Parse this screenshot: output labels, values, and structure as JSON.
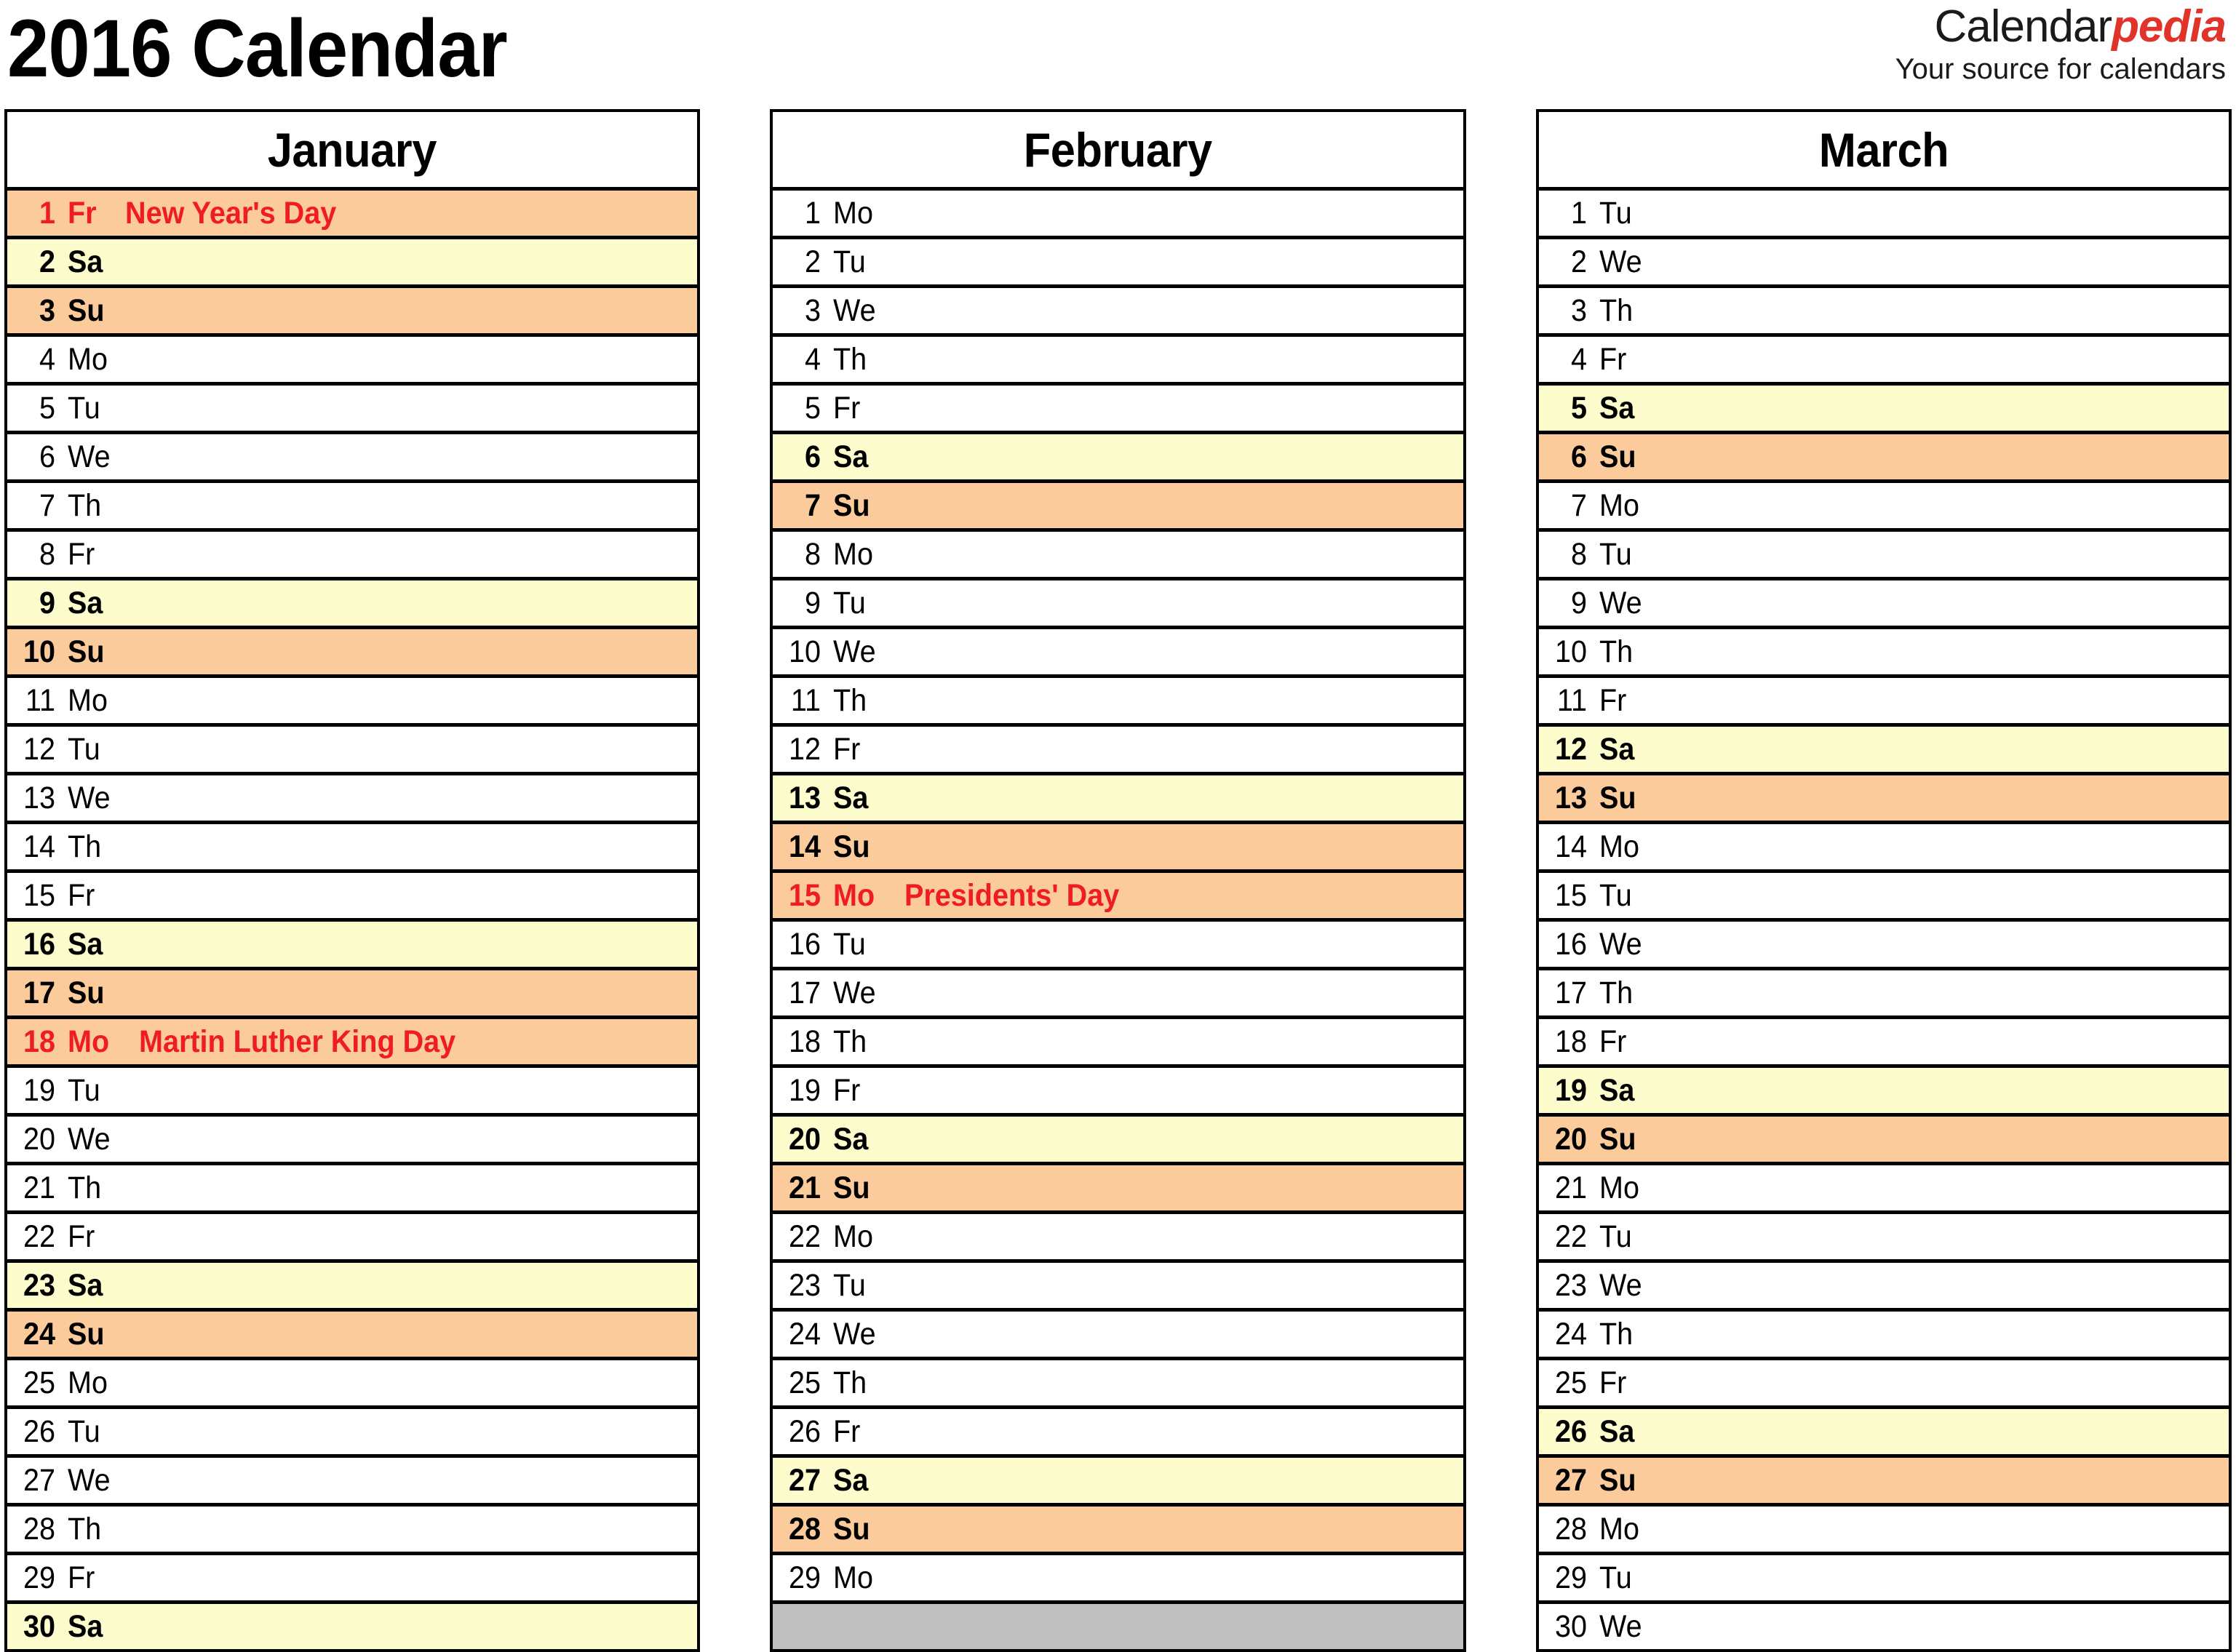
{
  "header": {
    "title": "2016 Calendar",
    "brand_name_black": "Calendar",
    "brand_name_red": "pedia",
    "brand_tagline": "Your source for calendars"
  },
  "colors": {
    "saturday_bg": "#FCFCCC",
    "sunday_bg": "#FBCB9C",
    "holiday_bg": "#FBCB9C",
    "holiday_text": "#EF1C22",
    "filler_bg": "#C0C0C0",
    "border": "#000000",
    "brand_red": "#E0342B"
  },
  "months": [
    {
      "name": "January",
      "days": [
        {
          "num": "1",
          "wd": "Fr",
          "event": "New Year's Day",
          "kind": "holiday"
        },
        {
          "num": "2",
          "wd": "Sa",
          "event": "",
          "kind": "sat"
        },
        {
          "num": "3",
          "wd": "Su",
          "event": "",
          "kind": "sun"
        },
        {
          "num": "4",
          "wd": "Mo",
          "event": "",
          "kind": "weekday"
        },
        {
          "num": "5",
          "wd": "Tu",
          "event": "",
          "kind": "weekday"
        },
        {
          "num": "6",
          "wd": "We",
          "event": "",
          "kind": "weekday"
        },
        {
          "num": "7",
          "wd": "Th",
          "event": "",
          "kind": "weekday"
        },
        {
          "num": "8",
          "wd": "Fr",
          "event": "",
          "kind": "weekday"
        },
        {
          "num": "9",
          "wd": "Sa",
          "event": "",
          "kind": "sat"
        },
        {
          "num": "10",
          "wd": "Su",
          "event": "",
          "kind": "sun"
        },
        {
          "num": "11",
          "wd": "Mo",
          "event": "",
          "kind": "weekday"
        },
        {
          "num": "12",
          "wd": "Tu",
          "event": "",
          "kind": "weekday"
        },
        {
          "num": "13",
          "wd": "We",
          "event": "",
          "kind": "weekday"
        },
        {
          "num": "14",
          "wd": "Th",
          "event": "",
          "kind": "weekday"
        },
        {
          "num": "15",
          "wd": "Fr",
          "event": "",
          "kind": "weekday"
        },
        {
          "num": "16",
          "wd": "Sa",
          "event": "",
          "kind": "sat"
        },
        {
          "num": "17",
          "wd": "Su",
          "event": "",
          "kind": "sun"
        },
        {
          "num": "18",
          "wd": "Mo",
          "event": "Martin Luther King Day",
          "kind": "holiday"
        },
        {
          "num": "19",
          "wd": "Tu",
          "event": "",
          "kind": "weekday"
        },
        {
          "num": "20",
          "wd": "We",
          "event": "",
          "kind": "weekday"
        },
        {
          "num": "21",
          "wd": "Th",
          "event": "",
          "kind": "weekday"
        },
        {
          "num": "22",
          "wd": "Fr",
          "event": "",
          "kind": "weekday"
        },
        {
          "num": "23",
          "wd": "Sa",
          "event": "",
          "kind": "sat"
        },
        {
          "num": "24",
          "wd": "Su",
          "event": "",
          "kind": "sun"
        },
        {
          "num": "25",
          "wd": "Mo",
          "event": "",
          "kind": "weekday"
        },
        {
          "num": "26",
          "wd": "Tu",
          "event": "",
          "kind": "weekday"
        },
        {
          "num": "27",
          "wd": "We",
          "event": "",
          "kind": "weekday"
        },
        {
          "num": "28",
          "wd": "Th",
          "event": "",
          "kind": "weekday"
        },
        {
          "num": "29",
          "wd": "Fr",
          "event": "",
          "kind": "weekday"
        },
        {
          "num": "30",
          "wd": "Sa",
          "event": "",
          "kind": "sat"
        }
      ]
    },
    {
      "name": "February",
      "days": [
        {
          "num": "1",
          "wd": "Mo",
          "event": "",
          "kind": "weekday"
        },
        {
          "num": "2",
          "wd": "Tu",
          "event": "",
          "kind": "weekday"
        },
        {
          "num": "3",
          "wd": "We",
          "event": "",
          "kind": "weekday"
        },
        {
          "num": "4",
          "wd": "Th",
          "event": "",
          "kind": "weekday"
        },
        {
          "num": "5",
          "wd": "Fr",
          "event": "",
          "kind": "weekday"
        },
        {
          "num": "6",
          "wd": "Sa",
          "event": "",
          "kind": "sat"
        },
        {
          "num": "7",
          "wd": "Su",
          "event": "",
          "kind": "sun"
        },
        {
          "num": "8",
          "wd": "Mo",
          "event": "",
          "kind": "weekday"
        },
        {
          "num": "9",
          "wd": "Tu",
          "event": "",
          "kind": "weekday"
        },
        {
          "num": "10",
          "wd": "We",
          "event": "",
          "kind": "weekday"
        },
        {
          "num": "11",
          "wd": "Th",
          "event": "",
          "kind": "weekday"
        },
        {
          "num": "12",
          "wd": "Fr",
          "event": "",
          "kind": "weekday"
        },
        {
          "num": "13",
          "wd": "Sa",
          "event": "",
          "kind": "sat"
        },
        {
          "num": "14",
          "wd": "Su",
          "event": "",
          "kind": "sun"
        },
        {
          "num": "15",
          "wd": "Mo",
          "event": "Presidents' Day",
          "kind": "holiday"
        },
        {
          "num": "16",
          "wd": "Tu",
          "event": "",
          "kind": "weekday"
        },
        {
          "num": "17",
          "wd": "We",
          "event": "",
          "kind": "weekday"
        },
        {
          "num": "18",
          "wd": "Th",
          "event": "",
          "kind": "weekday"
        },
        {
          "num": "19",
          "wd": "Fr",
          "event": "",
          "kind": "weekday"
        },
        {
          "num": "20",
          "wd": "Sa",
          "event": "",
          "kind": "sat"
        },
        {
          "num": "21",
          "wd": "Su",
          "event": "",
          "kind": "sun"
        },
        {
          "num": "22",
          "wd": "Mo",
          "event": "",
          "kind": "weekday"
        },
        {
          "num": "23",
          "wd": "Tu",
          "event": "",
          "kind": "weekday"
        },
        {
          "num": "24",
          "wd": "We",
          "event": "",
          "kind": "weekday"
        },
        {
          "num": "25",
          "wd": "Th",
          "event": "",
          "kind": "weekday"
        },
        {
          "num": "26",
          "wd": "Fr",
          "event": "",
          "kind": "weekday"
        },
        {
          "num": "27",
          "wd": "Sa",
          "event": "",
          "kind": "sat"
        },
        {
          "num": "28",
          "wd": "Su",
          "event": "",
          "kind": "sun"
        },
        {
          "num": "29",
          "wd": "Mo",
          "event": "",
          "kind": "weekday"
        },
        {
          "num": "",
          "wd": "",
          "event": "",
          "kind": "filler"
        }
      ]
    },
    {
      "name": "March",
      "days": [
        {
          "num": "1",
          "wd": "Tu",
          "event": "",
          "kind": "weekday"
        },
        {
          "num": "2",
          "wd": "We",
          "event": "",
          "kind": "weekday"
        },
        {
          "num": "3",
          "wd": "Th",
          "event": "",
          "kind": "weekday"
        },
        {
          "num": "4",
          "wd": "Fr",
          "event": "",
          "kind": "weekday"
        },
        {
          "num": "5",
          "wd": "Sa",
          "event": "",
          "kind": "sat"
        },
        {
          "num": "6",
          "wd": "Su",
          "event": "",
          "kind": "sun"
        },
        {
          "num": "7",
          "wd": "Mo",
          "event": "",
          "kind": "weekday"
        },
        {
          "num": "8",
          "wd": "Tu",
          "event": "",
          "kind": "weekday"
        },
        {
          "num": "9",
          "wd": "We",
          "event": "",
          "kind": "weekday"
        },
        {
          "num": "10",
          "wd": "Th",
          "event": "",
          "kind": "weekday"
        },
        {
          "num": "11",
          "wd": "Fr",
          "event": "",
          "kind": "weekday"
        },
        {
          "num": "12",
          "wd": "Sa",
          "event": "",
          "kind": "sat"
        },
        {
          "num": "13",
          "wd": "Su",
          "event": "",
          "kind": "sun"
        },
        {
          "num": "14",
          "wd": "Mo",
          "event": "",
          "kind": "weekday"
        },
        {
          "num": "15",
          "wd": "Tu",
          "event": "",
          "kind": "weekday"
        },
        {
          "num": "16",
          "wd": "We",
          "event": "",
          "kind": "weekday"
        },
        {
          "num": "17",
          "wd": "Th",
          "event": "",
          "kind": "weekday"
        },
        {
          "num": "18",
          "wd": "Fr",
          "event": "",
          "kind": "weekday"
        },
        {
          "num": "19",
          "wd": "Sa",
          "event": "",
          "kind": "sat"
        },
        {
          "num": "20",
          "wd": "Su",
          "event": "",
          "kind": "sun"
        },
        {
          "num": "21",
          "wd": "Mo",
          "event": "",
          "kind": "weekday"
        },
        {
          "num": "22",
          "wd": "Tu",
          "event": "",
          "kind": "weekday"
        },
        {
          "num": "23",
          "wd": "We",
          "event": "",
          "kind": "weekday"
        },
        {
          "num": "24",
          "wd": "Th",
          "event": "",
          "kind": "weekday"
        },
        {
          "num": "25",
          "wd": "Fr",
          "event": "",
          "kind": "weekday"
        },
        {
          "num": "26",
          "wd": "Sa",
          "event": "",
          "kind": "sat"
        },
        {
          "num": "27",
          "wd": "Su",
          "event": "",
          "kind": "sun"
        },
        {
          "num": "28",
          "wd": "Mo",
          "event": "",
          "kind": "weekday"
        },
        {
          "num": "29",
          "wd": "Tu",
          "event": "",
          "kind": "weekday"
        },
        {
          "num": "30",
          "wd": "We",
          "event": "",
          "kind": "weekday"
        }
      ]
    }
  ]
}
